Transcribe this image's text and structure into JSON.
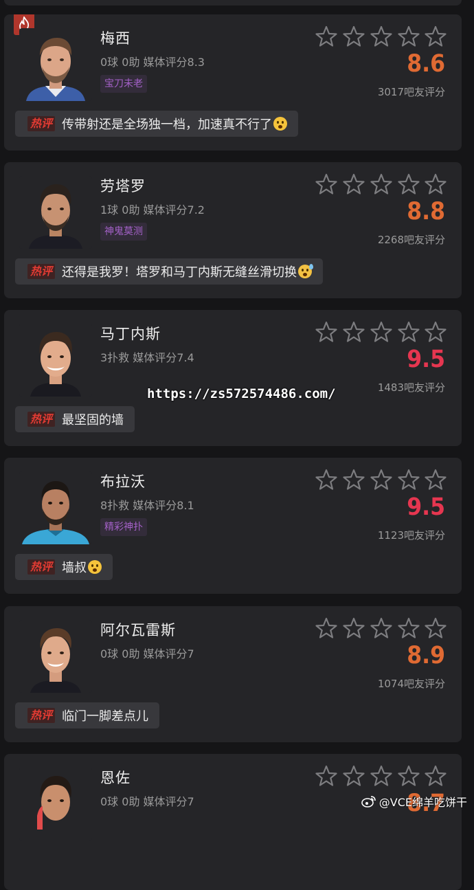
{
  "comment_badge": "热评",
  "players": [
    {
      "name": "梅西",
      "stats": "0球 0助  媒体评分8.3",
      "tag": "宝刀未老",
      "score": "8.6",
      "score_color": "#e06a33",
      "votes": "3017吧友评分",
      "comment": "传带射还是全场独一档，加速真不行了",
      "emoji": "shocked-emoji",
      "hot_flag": true
    },
    {
      "name": "劳塔罗",
      "stats": "1球 0助  媒体评分7.2",
      "tag": "神鬼莫测",
      "score": "8.8",
      "score_color": "#e06a33",
      "votes": "2268吧友评分",
      "comment": "还得是我罗！塔罗和马丁内斯无缝丝滑切换",
      "emoji": "sweat-smile-emoji",
      "hot_flag": false
    },
    {
      "name": "马丁内斯",
      "stats": "3扑救  媒体评分7.4",
      "tag": "",
      "score": "9.5",
      "score_color": "#e63650",
      "votes": "1483吧友评分",
      "comment": "最坚固的墙",
      "emoji": "",
      "hot_flag": false
    },
    {
      "name": "布拉沃",
      "stats": "8扑救  媒体评分8.1",
      "tag": "精彩神扑",
      "score": "9.5",
      "score_color": "#e63650",
      "votes": "1123吧友评分",
      "comment": "墙叔",
      "emoji": "astonished-emoji",
      "hot_flag": false
    },
    {
      "name": "阿尔瓦雷斯",
      "stats": "0球 0助  媒体评分7",
      "tag": "",
      "score": "8.9",
      "score_color": "#e06a33",
      "votes": "1074吧友评分",
      "comment": "临门一脚差点儿",
      "emoji": "",
      "hot_flag": false
    },
    {
      "name": "恩佐",
      "stats": "0球 0助  媒体评分7",
      "tag": "",
      "score": "8.7",
      "score_color": "#e06a33",
      "votes": "",
      "comment": "",
      "emoji": "",
      "hot_flag": false
    }
  ],
  "watermark": {
    "url": "https://zs572574486.com/",
    "weibo": "@VCE绵羊吃饼干"
  },
  "icons": {
    "star": "star-outline-icon",
    "flame": "flame-icon",
    "weibo": "weibo-icon"
  }
}
